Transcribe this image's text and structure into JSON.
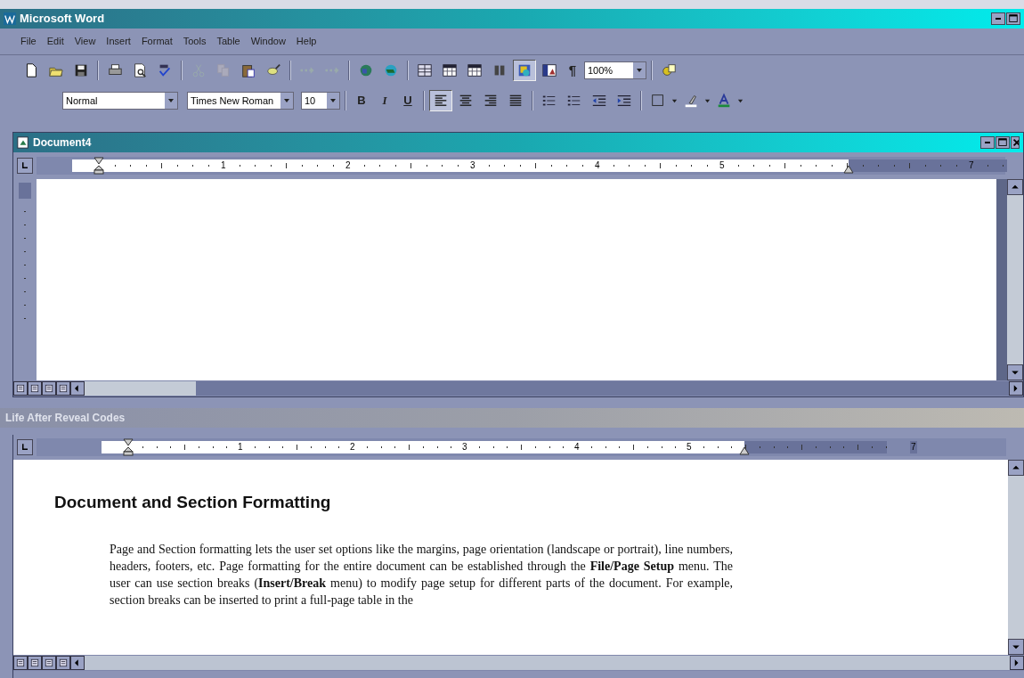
{
  "window": {
    "title": "Microsoft Word"
  },
  "menu": [
    "File",
    "Edit",
    "View",
    "Insert",
    "Format",
    "Tools",
    "Table",
    "Window",
    "Help"
  ],
  "standard_toolbar": {
    "show_hide": "¶",
    "zoom": "100%"
  },
  "formatting_toolbar": {
    "style": "Normal",
    "font": "Times New Roman",
    "size": "10",
    "bold": "B",
    "italic": "I",
    "underline": "U",
    "alignment": [
      {
        "kind": "left",
        "selected": true
      },
      {
        "kind": "center",
        "selected": false
      },
      {
        "kind": "right",
        "selected": false
      },
      {
        "kind": "justify",
        "selected": false
      }
    ]
  },
  "document_window": {
    "title": "Document4",
    "ruler": [
      "1",
      "2",
      "3",
      "4",
      "5",
      "7"
    ]
  },
  "pane": {
    "title": "Life After Reveal Codes",
    "ruler": [
      "1",
      "2",
      "3",
      "4",
      "5",
      "7"
    ],
    "heading": "Document and Section Formatting",
    "paragraph": "Page and Section formatting lets the user set options like the margins, page orientation (landscape or portrait), line numbers, headers, footers, etc. Page formatting for the entire document can be established through the **File/Page Setup** menu.  The user can use section breaks (**Insert/Break** menu) to modify page setup for different parts of the document.  For example, section breaks can be inserted to print a full-page table in the"
  }
}
